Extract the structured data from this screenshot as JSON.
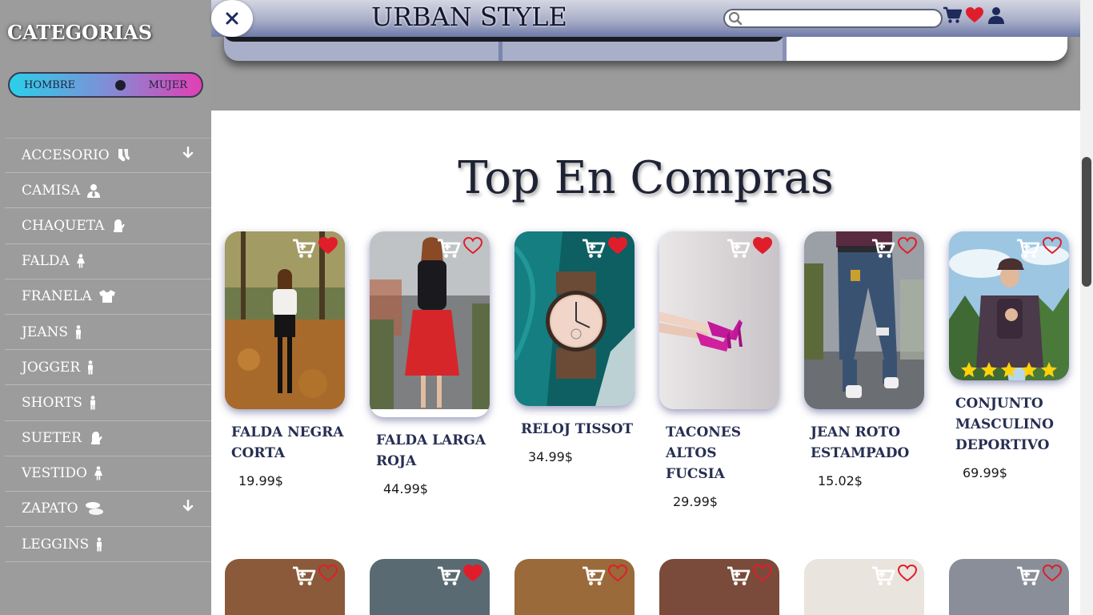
{
  "sidebar": {
    "title": "CATEGORIAS",
    "toggle": {
      "left": "HOMBRE",
      "right": "MUJER"
    },
    "categories": [
      {
        "label": "ACCESORIO",
        "icon": "socks-icon",
        "dropdown": true
      },
      {
        "label": "CAMISA",
        "icon": "user-tie-icon",
        "dropdown": false
      },
      {
        "label": "CHAQUETA",
        "icon": "mitten-icon",
        "dropdown": false
      },
      {
        "label": "FALDA",
        "icon": "person-dress-icon",
        "dropdown": false
      },
      {
        "label": "FRANELA",
        "icon": "tshirt-icon",
        "dropdown": false
      },
      {
        "label": "JEANS",
        "icon": "person-icon",
        "dropdown": false
      },
      {
        "label": "JOGGER",
        "icon": "person-icon",
        "dropdown": false
      },
      {
        "label": "SHORTS",
        "icon": "person-icon",
        "dropdown": false
      },
      {
        "label": "SUETER",
        "icon": "mitten-icon",
        "dropdown": false
      },
      {
        "label": "VESTIDO",
        "icon": "person-dress-icon",
        "dropdown": false
      },
      {
        "label": "ZAPATO",
        "icon": "shoe-prints-icon",
        "dropdown": true
      },
      {
        "label": "LEGGINS",
        "icon": "person-icon",
        "dropdown": false
      }
    ]
  },
  "header": {
    "brand": "URBAN STYLE",
    "search_placeholder": ""
  },
  "main": {
    "title": "Top En Compras",
    "products": [
      {
        "name": "FALDA NEGRA CORTA",
        "price": "19.99$",
        "favorited": true
      },
      {
        "name": "FALDA LARGA ROJA",
        "price": "44.99$",
        "favorited": false
      },
      {
        "name": "RELOJ TISSOT",
        "price": "34.99$",
        "favorited": true
      },
      {
        "name": "TACONES ALTOS FUCSIA",
        "price": "29.99$",
        "favorited": true
      },
      {
        "name": "JEAN ROTO ESTAMPADO",
        "price": "15.02$",
        "favorited": false
      },
      {
        "name": "CONJUNTO MASCULINO DEPORTIVO",
        "price": "69.99$",
        "favorited": false,
        "rating": 5
      }
    ],
    "next_row_favorited": [
      false,
      true,
      false,
      false,
      false,
      false
    ]
  },
  "colors": {
    "accent_text": "#262e52",
    "heart_red": "#e01e2b",
    "sidebar_bg": "#9c9c9c",
    "header_navy": "#1e2a5c"
  }
}
